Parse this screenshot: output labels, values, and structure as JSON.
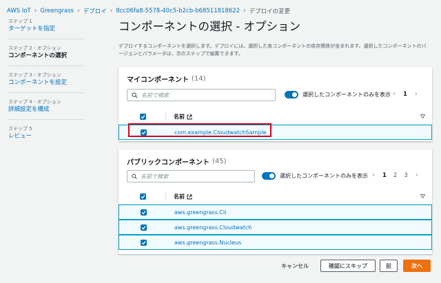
{
  "breadcrumb": {
    "items": [
      "AWS IoT",
      "Greengrass",
      "デプロイ",
      "8cc06fa8-5578-40c5-b2cb-b68511818622"
    ],
    "current": "デプロイの変更"
  },
  "steps": [
    {
      "num": "ステップ 1",
      "name": "ターゲットを指定"
    },
    {
      "num": "ステップ 2 - オプション",
      "name": "コンポーネントの選択"
    },
    {
      "num": "ステップ 3 - オプション",
      "name": "コンポーネントを設定"
    },
    {
      "num": "ステップ 4 - オプション",
      "name": "詳細設定を構成"
    },
    {
      "num": "ステップ 5",
      "name": "レビュー"
    }
  ],
  "main": {
    "title": "コンポーネントの選択 - オプション",
    "description": "デプロイするコンポーネントを選択します。デプロイには、選択した各コンポーネントの依存関係が含まれます。選択したコンポーネントのバージョンとパラメータは、次のステップで編集できます。"
  },
  "my_components": {
    "title": "マイコンポーネント",
    "count": "(14)",
    "search_placeholder": "名前で検索",
    "toggle_label": "選択したコンポーネントのみを表示",
    "pages": [
      "1"
    ],
    "column_name": "名前",
    "rows": [
      "com.example.CloudwatchSample"
    ]
  },
  "public_components": {
    "title": "パブリックコンポーネント",
    "count": "(45)",
    "search_placeholder": "名前で検索",
    "toggle_label": "選択したコンポーネントのみを表示",
    "pages": [
      "1",
      "2",
      "3"
    ],
    "column_name": "名前",
    "rows": [
      "aws.greengrass.Cli",
      "aws.greengrass.Cloudwatch",
      "aws.greengrass.Nucleus"
    ]
  },
  "footer": {
    "cancel": "キャンセル",
    "skip": "確認にスキップ",
    "previous": "前",
    "next": "次へ"
  },
  "colors": {
    "link": "#0073bb",
    "primary": "#ec7211",
    "highlight": "#d0021b"
  }
}
